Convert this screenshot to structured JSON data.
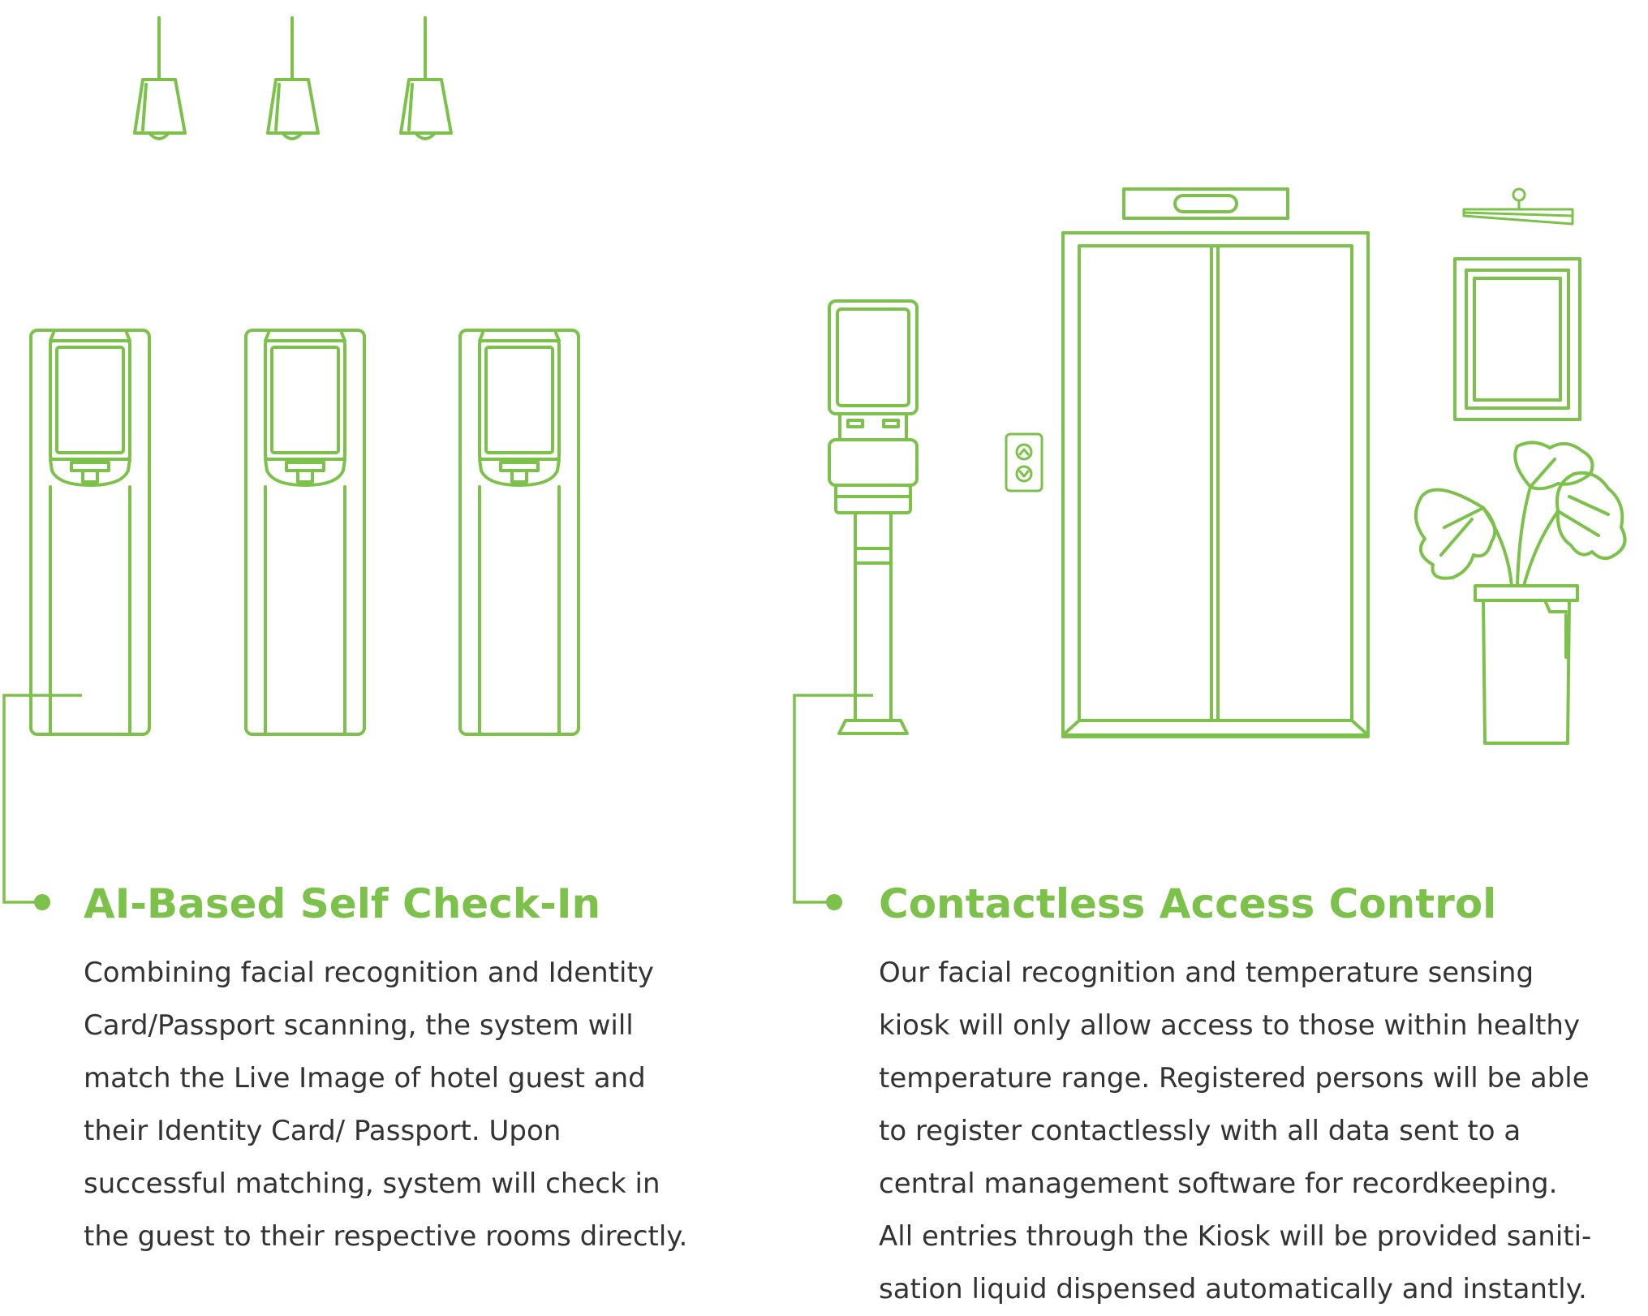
{
  "theme": {
    "accent_color": "#7cc24a",
    "text_color": "#333333",
    "background_color": "#ffffff"
  },
  "illustration": {
    "items": [
      "pendant-lamp-icon",
      "check-in-kiosk-icon",
      "temperature-kiosk-icon",
      "elevator-icon",
      "elevator-call-button-icon",
      "exit-sign-icon",
      "picture-frame-icon",
      "potted-plant-icon"
    ]
  },
  "features": [
    {
      "title": "AI-Based Self Check-In",
      "body_lines": [
        "Combining facial recognition and Identity",
        "Card/Passport scanning, the system will",
        "match the Live Image of hotel guest and",
        "their Identity Card/ Passport. Upon",
        "successful matching, system will check in",
        "the guest to their respective rooms directly."
      ]
    },
    {
      "title": "Contactless Access Control",
      "body_lines": [
        "Our facial recognition and temperature sensing",
        "kiosk will only allow access to those within healthy",
        "temperature range. Registered persons will be able",
        "to register contactlessly with all data sent to a",
        "central management software for recordkeeping.",
        "All entries through the Kiosk will be provided saniti-",
        "sation liquid dispensed automatically and instantly."
      ]
    }
  ]
}
